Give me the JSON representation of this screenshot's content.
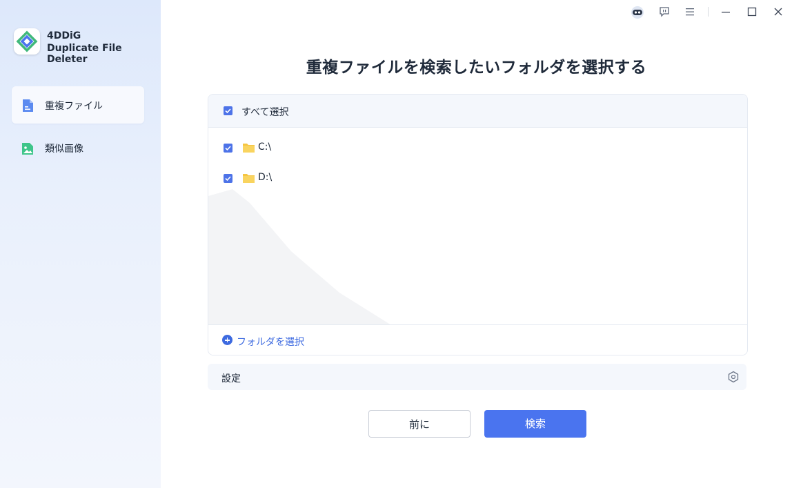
{
  "app": {
    "name_line1": "4DDiG",
    "name_line2": "Duplicate File Deleter"
  },
  "sidebar": {
    "items": [
      {
        "label": "重複ファイル",
        "icon": "document-icon",
        "active": true
      },
      {
        "label": "類似画像",
        "icon": "image-icon",
        "active": false
      }
    ]
  },
  "titlebar": {
    "icons": [
      "robot-icon",
      "feedback-icon",
      "menu-icon",
      "minimize-icon",
      "maximize-icon",
      "close-icon"
    ]
  },
  "main": {
    "title": "重複ファイルを検索したいフォルダを選択する",
    "select_all_label": "すべて選択",
    "select_all_checked": true,
    "folders": [
      {
        "path": "C:\\",
        "checked": true
      },
      {
        "path": "D:\\",
        "checked": true
      }
    ],
    "add_folder_label": "フォルダを選択",
    "settings_label": "設定",
    "prev_button": "前に",
    "search_button": "検索"
  },
  "colors": {
    "accent": "#4a74ef",
    "link": "#3d6ae0",
    "folder": "#f5c542"
  }
}
